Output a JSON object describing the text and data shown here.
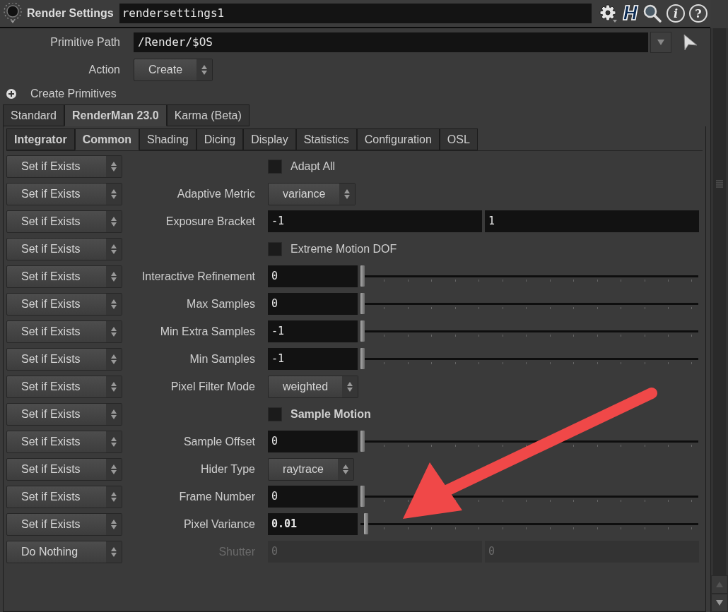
{
  "node": {
    "type_label": "Render Settings",
    "name": "rendersettings1"
  },
  "toolbar": [
    {
      "kind": "gear"
    },
    {
      "kind": "logo",
      "glyph": "H"
    },
    {
      "kind": "search"
    },
    {
      "kind": "info",
      "glyph": "i"
    },
    {
      "kind": "help",
      "glyph": "?"
    }
  ],
  "primitive_path": {
    "label": "Primitive Path",
    "value": "/Render/$OS"
  },
  "action": {
    "label": "Action",
    "value": "Create"
  },
  "section": {
    "label": "Create Primitives",
    "expanded": false
  },
  "tabs": [
    {
      "label": "Standard",
      "selected": false
    },
    {
      "label": "RenderMan 23.0",
      "selected": true
    },
    {
      "label": "Karma (Beta)",
      "selected": false
    }
  ],
  "subtabs": [
    {
      "label": "Integrator",
      "selected": false,
      "modified": true
    },
    {
      "label": "Common",
      "selected": true,
      "modified": false
    },
    {
      "label": "Shading",
      "selected": false,
      "modified": false
    },
    {
      "label": "Dicing",
      "selected": false,
      "modified": false
    },
    {
      "label": "Display",
      "selected": false,
      "modified": false
    },
    {
      "label": "Statistics",
      "selected": false,
      "modified": false
    },
    {
      "label": "Configuration",
      "selected": false,
      "modified": false
    },
    {
      "label": "OSL",
      "selected": false,
      "modified": false
    }
  ],
  "params": [
    {
      "mode": "Set if Exists",
      "kind": "toggle",
      "label": "Adapt All",
      "checked": false,
      "modified": false,
      "disabled": false
    },
    {
      "mode": "Set if Exists",
      "kind": "menu",
      "label": "Adaptive Metric",
      "value": "variance",
      "modified": false,
      "disabled": false
    },
    {
      "mode": "Set if Exists",
      "kind": "pair",
      "label": "Exposure Bracket",
      "values": [
        "-1",
        "1"
      ],
      "modified": false,
      "disabled": false
    },
    {
      "mode": "Set if Exists",
      "kind": "toggle",
      "label": "Extreme Motion DOF",
      "checked": false,
      "modified": false,
      "disabled": false
    },
    {
      "mode": "Set if Exists",
      "kind": "slider",
      "label": "Interactive Refinement",
      "value": "0",
      "level": 0,
      "modified": false,
      "disabled": false
    },
    {
      "mode": "Set if Exists",
      "kind": "slider",
      "label": "Max Samples",
      "value": "0",
      "level": 0,
      "modified": false,
      "disabled": false
    },
    {
      "mode": "Set if Exists",
      "kind": "slider",
      "label": "Min Extra Samples",
      "value": "-1",
      "level": 0,
      "modified": false,
      "disabled": false
    },
    {
      "mode": "Set if Exists",
      "kind": "slider",
      "label": "Min Samples",
      "value": "-1",
      "level": 0,
      "modified": false,
      "disabled": false
    },
    {
      "mode": "Set if Exists",
      "kind": "menu",
      "label": "Pixel Filter Mode",
      "value": "weighted",
      "modified": false,
      "disabled": false
    },
    {
      "mode": "Set if Exists",
      "kind": "toggle",
      "label": "Sample Motion",
      "checked": false,
      "modified": true,
      "disabled": false
    },
    {
      "mode": "Set if Exists",
      "kind": "slider",
      "label": "Sample Offset",
      "value": "0",
      "level": 0,
      "modified": false,
      "disabled": false
    },
    {
      "mode": "Set if Exists",
      "kind": "menu",
      "label": "Hider Type",
      "value": "raytrace",
      "modified": false,
      "disabled": false
    },
    {
      "mode": "Set if Exists",
      "kind": "slider",
      "label": "Frame Number",
      "value": "0",
      "level": 0,
      "modified": false,
      "disabled": false
    },
    {
      "mode": "Set if Exists",
      "kind": "slider",
      "label": "Pixel Variance",
      "value": "0.01",
      "level": 0.01,
      "modified": true,
      "disabled": false
    },
    {
      "mode": "Do Nothing",
      "kind": "pair",
      "label": "Shutter",
      "values": [
        "0",
        "0"
      ],
      "modified": false,
      "disabled": true
    }
  ]
}
